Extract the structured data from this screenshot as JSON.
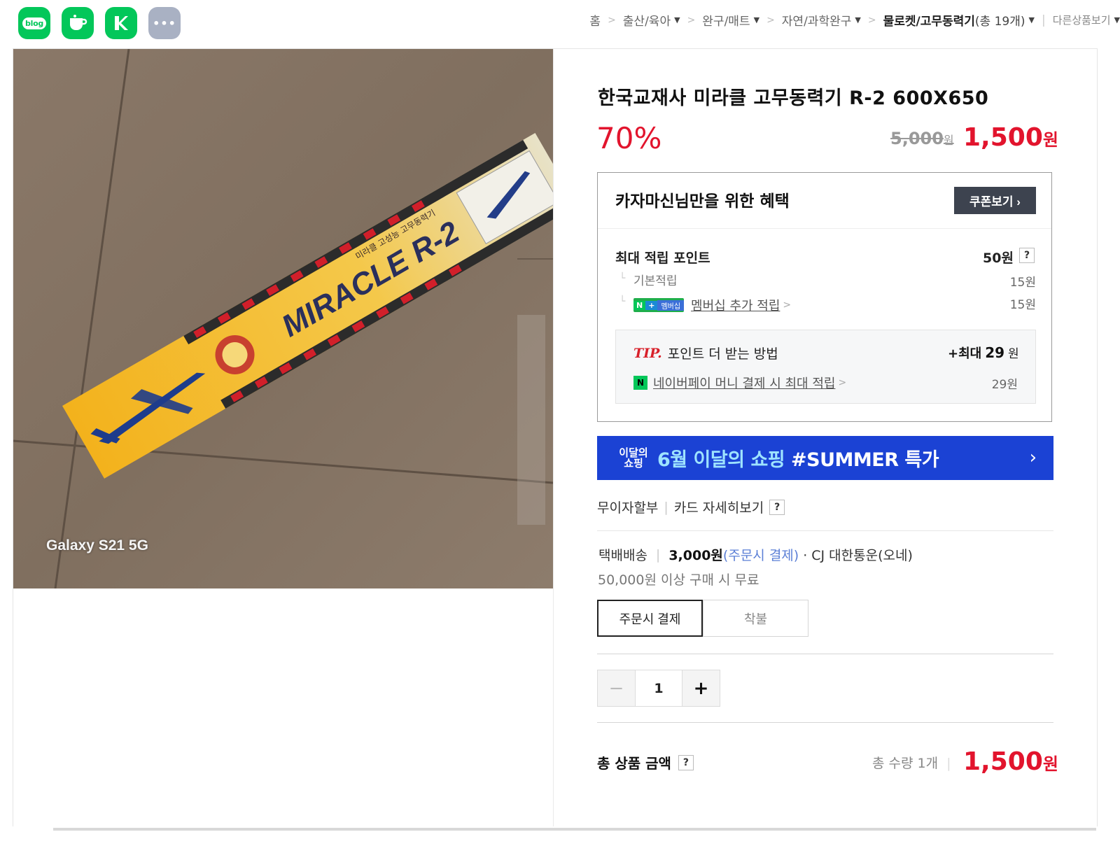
{
  "share": {
    "blog_label": "blog",
    "icons": [
      "blog-icon",
      "cafe-icon",
      "band-icon",
      "more-icon"
    ],
    "more_label": "•••"
  },
  "breadcrumb": {
    "items": [
      "홈",
      "출산/육아",
      "완구/매트",
      "자연/과학완구"
    ],
    "current": "물로켓/고무동력기",
    "current_count": "(총 19개)",
    "other": "다른상품보기"
  },
  "photo": {
    "caption": "Galaxy S21 5G",
    "box_text": "MIRACLE R-2",
    "box_subtext": "미라클 고성능 고무동력기"
  },
  "product": {
    "title": "한국교재사 미라클 고무동력기 R-2 600X650",
    "discount": "70%",
    "original_price": "5,000",
    "original_unit": "원",
    "sale_price": "1,500",
    "sale_unit": "원"
  },
  "benefit": {
    "title": "카자마신님만을 위한 혜택",
    "coupon_label": "쿠폰보기 ›",
    "points_label": "최대 적립 포인트",
    "points_value": "50원",
    "basic_label": "기본적립",
    "basic_value": "15원",
    "membership_badge_n": "N",
    "membership_badge_plus": "+",
    "membership_badge_text": "멤버십",
    "membership_label": "멤버십 추가 적립",
    "membership_value": "15원",
    "tip_tag": "TIP.",
    "tip_text": "포인트 더 받는 방법",
    "tip_max_prefix": "+최대",
    "tip_max_value": "29",
    "tip_max_unit": "원",
    "npay_badge": "N",
    "npay_label": "네이버페이 머니 결제 시 최대 적립",
    "npay_value": "29원",
    "help": "?"
  },
  "banner": {
    "logo_line1": "이달의",
    "logo_line2": "쇼핑",
    "text_highlight": "6월 이달의 쇼핑",
    "text_main": " #SUMMER 특가",
    "arrow": "›"
  },
  "installment": {
    "label": "무이자할부",
    "card_label": "카드 자세히보기",
    "help": "?"
  },
  "shipping": {
    "type": "택배배송",
    "fee": "3,000원",
    "fee_note": "(주문시 결제)",
    "carrier": "· CJ 대한통운(오네)",
    "free_note": "50,000원 이상 구매 시 무료",
    "options": [
      "주문시 결제",
      "착불"
    ]
  },
  "quantity": {
    "minus": "−",
    "value": "1",
    "plus": "+"
  },
  "total": {
    "label": "총 상품 금액",
    "help": "?",
    "qty_label": "총 수량 1개",
    "price": "1,500",
    "unit": "원"
  },
  "colors": {
    "accent_red": "#e2142d",
    "naver_green": "#03c75a",
    "banner_blue": "#1b42d4",
    "coupon_btn": "#3d434f"
  }
}
